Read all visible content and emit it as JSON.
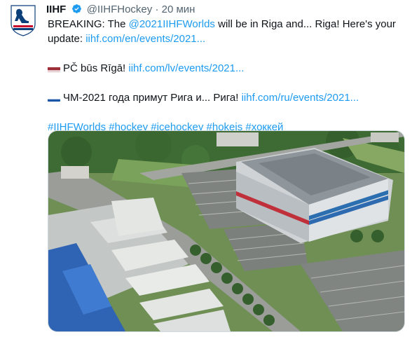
{
  "author": {
    "name": "IIHF",
    "handle": "@IIHFHockey",
    "separator": "·",
    "time": "20 мин",
    "avatar_icon": "iihf-logo-icon",
    "verified_icon": "verified-badge-icon"
  },
  "tweet": {
    "line1_text": "BREAKING: The ",
    "line1_mention": "@2021IIHFWorlds",
    "line1_rest": " will be in Riga and... Riga! Here's your",
    "line2_text": "update: ",
    "line2_link": "iihf.com/en/events/2021...",
    "lv_flag_icon": "latvia-flag-icon",
    "lv_text": "PČ būs Rīgā! ",
    "lv_link": "iihf.com/lv/events/2021...",
    "ru_flag_icon": "russia-flag-icon",
    "ru_text": "ЧМ-2021 года примут Рига и... Рига! ",
    "ru_link": "iihf.com/ru/events/2021...",
    "hashtags": [
      "#IIHFWorlds",
      "#hockey",
      "#icehockey",
      "#hokejs",
      "#хоккей"
    ]
  },
  "colors": {
    "link": "#1d9bf0",
    "text": "#0f1419",
    "secondary": "#536471",
    "verified": "#1d9bf0"
  }
}
